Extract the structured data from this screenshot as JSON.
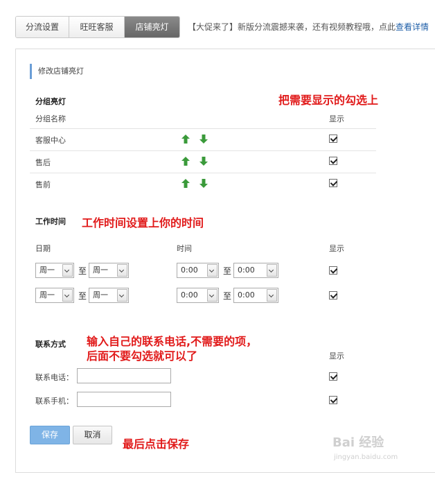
{
  "tabs": [
    {
      "label": "分流设置"
    },
    {
      "label": "旺旺客服"
    },
    {
      "label": "店铺亮灯"
    }
  ],
  "notice": {
    "text": "【大促来了】新版分流震撼来袭，还有视频教程哦，点此",
    "link": "查看详情"
  },
  "section_title": "修改店铺亮灯",
  "groups": {
    "heading": "分组亮灯",
    "col_name": "分组名称",
    "col_show": "显示",
    "rows": [
      {
        "name": "客服中心",
        "show": true
      },
      {
        "name": "售后",
        "show": true
      },
      {
        "name": "售前",
        "show": true
      }
    ]
  },
  "work_time": {
    "heading": "工作时间",
    "col_date": "日期",
    "col_time": "时间",
    "col_show": "显示",
    "separator": "至",
    "rows": [
      {
        "from_day": "周一",
        "to_day": "周一",
        "from_time": "0:00",
        "to_time": "0:00",
        "show": true
      },
      {
        "from_day": "周一",
        "to_day": "周一",
        "from_time": "0:00",
        "to_time": "0:00",
        "show": true
      }
    ]
  },
  "contact": {
    "heading": "联系方式",
    "col_show": "显示",
    "phone_label": "联系电话：",
    "phone_value": "",
    "mobile_label": "联系手机：",
    "mobile_value": "",
    "phone_show": true,
    "mobile_show": true
  },
  "buttons": {
    "save": "保存",
    "cancel": "取消"
  },
  "annotations": {
    "groups": "把需要显示的勾选上",
    "work_time": "工作时间设置上你的时间",
    "contact_line1": "输入自己的联系电话,不需要的项，",
    "contact_line2": "后面不要勾选就可以了",
    "save": "最后点击保存"
  },
  "watermark": {
    "brand": "Bai 经验",
    "url": "jingyan.baidu.com"
  },
  "colors": {
    "accent_blue": "#7fb4e6",
    "annotation_red": "#e11a1a",
    "arrow_green": "#3a9a3a",
    "link_blue": "#1f5fa8"
  }
}
